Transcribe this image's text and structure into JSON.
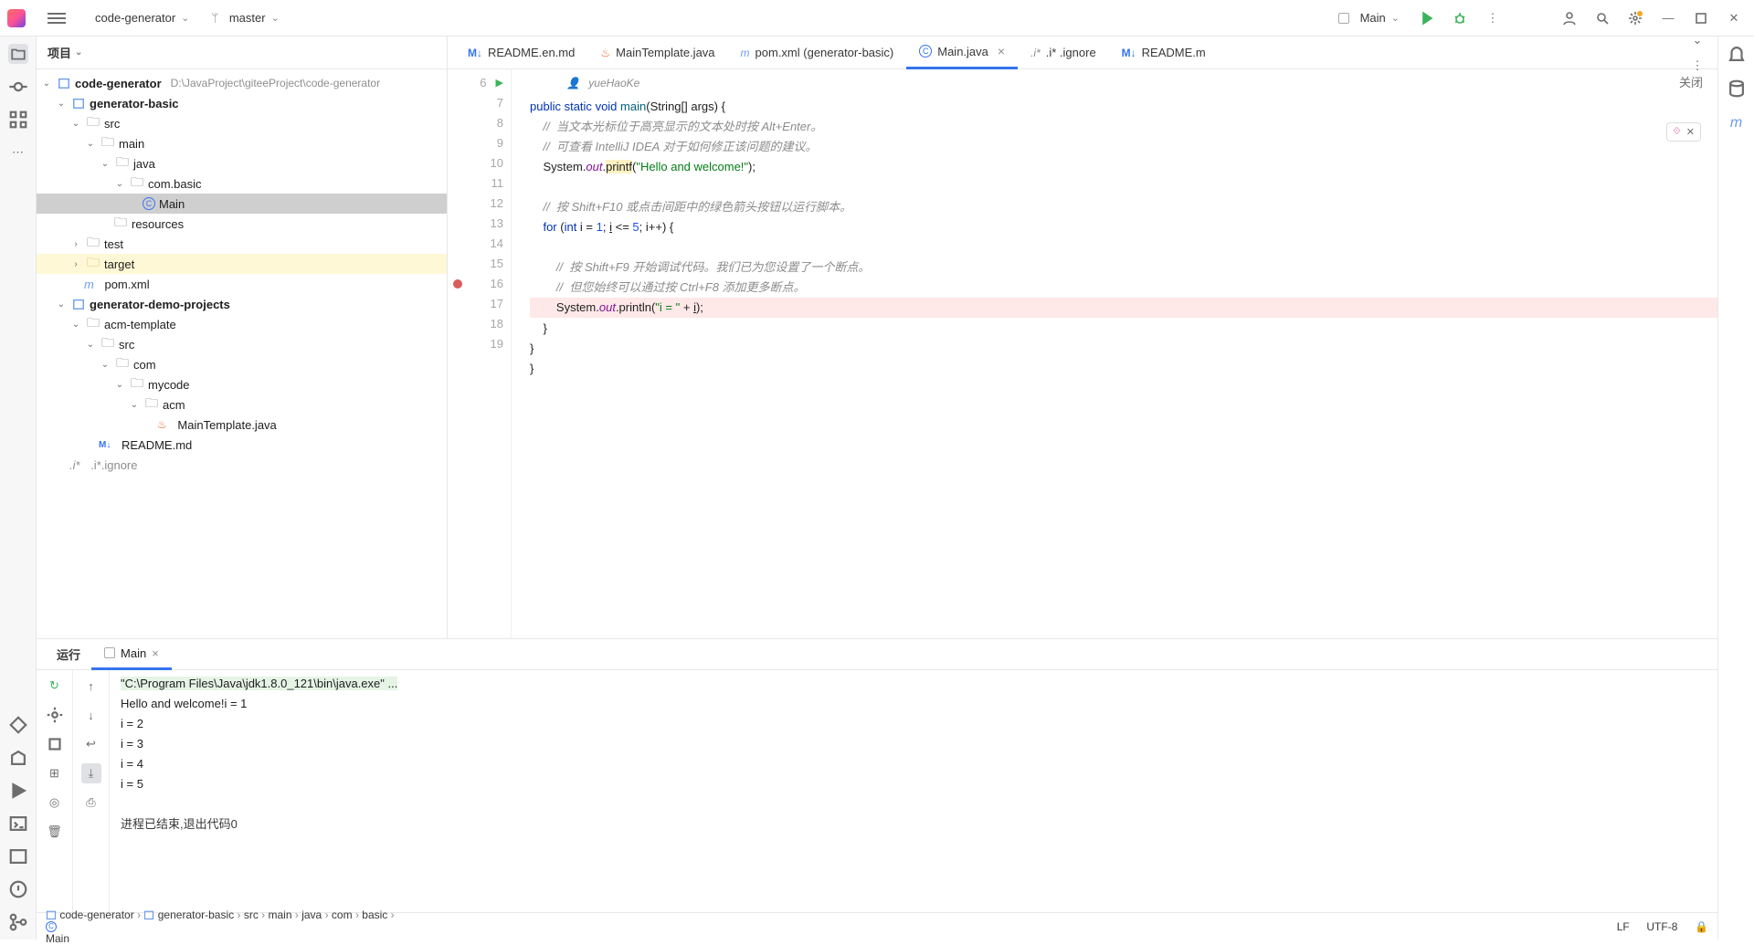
{
  "top": {
    "project": "code-generator",
    "branch": "master",
    "runConfig": "Main"
  },
  "panel": {
    "title": "项目"
  },
  "tree": {
    "root": "code-generator",
    "rootPath": "D:\\JavaProject\\giteeProject\\code-generator",
    "n1": "generator-basic",
    "n2": "src",
    "n3": "main",
    "n4": "java",
    "n5": "com.basic",
    "n6": "Main",
    "n7": "resources",
    "n8": "test",
    "n9": "target",
    "n10": "pom.xml",
    "n11": "generator-demo-projects",
    "n12": "acm-template",
    "n13": "src",
    "n14": "com",
    "n15": "mycode",
    "n16": "acm",
    "n17": "MainTemplate.java",
    "n18": "README.md",
    "n19": ".i*.ignore"
  },
  "tabs": [
    {
      "label": "README.en.md",
      "icon": "md"
    },
    {
      "label": "MainTemplate.java",
      "icon": "jv"
    },
    {
      "label": "pom.xml (generator-basic)",
      "icon": "mvn"
    },
    {
      "label": "Main.java",
      "icon": "cblue",
      "active": true,
      "close": true
    },
    {
      "label": ".i* .ignore",
      "icon": ""
    },
    {
      "label": "README.m",
      "icon": "md"
    }
  ],
  "editor": {
    "author": "yueHaoKe",
    "closeLabel": "关闭",
    "lines": [
      {
        "n": 6,
        "run": true,
        "html": "<span class='kw'>public</span> <span class='kw'>static</span> <span class='kw'>void</span> <span style='color:#00627a'>main</span>(String[] args) {"
      },
      {
        "n": 7,
        "html": "    <span class='cmt'>//  当文本光标位于高亮显示的文本处时按 Alt+Enter。</span>"
      },
      {
        "n": 8,
        "html": "    <span class='cmt'>//  可查看 IntelliJ IDEA 对于如何修正该问题的建议。</span>"
      },
      {
        "n": 9,
        "html": "    System.<span class='fld'>out</span>.<span class='hly'>printf</span>(<span class='str'>\"Hello and welcome!\"</span>);"
      },
      {
        "n": 10,
        "html": ""
      },
      {
        "n": 11,
        "html": "    <span class='cmt'>//  按 Shift+F10 或点击间距中的绿色箭头按钮以运行脚本。</span>"
      },
      {
        "n": 12,
        "html": "    <span class='kw'>for</span> (<span class='kw'>int</span> i = <span class='num'>1</span>; <u>i</u> &lt;= <span class='num'>5</span>; i++) {"
      },
      {
        "n": 13,
        "html": ""
      },
      {
        "n": 14,
        "html": "        <span class='cmt'>//  按 Shift+F9 开始调试代码。我们已为您设置了一个断点。</span>"
      },
      {
        "n": 15,
        "html": "        <span class='cmt'>//  但您始终可以通过按 Ctrl+F8 添加更多断点。</span>"
      },
      {
        "n": 16,
        "bp": true,
        "err": true,
        "html": "        System.<span class='fld'>out</span>.println(<span class='str'>\"i = \"</span> + <u>i</u>);"
      },
      {
        "n": 17,
        "html": "    }"
      },
      {
        "n": 18,
        "html": "}"
      },
      {
        "n": 19,
        "html": "}"
      }
    ]
  },
  "run": {
    "title": "运行",
    "tab": "Main",
    "cmd": "\"C:\\Program Files\\Java\\jdk1.8.0_121\\bin\\java.exe\" ...",
    "out": [
      "Hello and welcome!i = 1",
      "i = 2",
      "i = 3",
      "i = 4",
      "i = 5"
    ],
    "exit": "进程已结束,退出代码0"
  },
  "breadcrumb": [
    "code-generator",
    "generator-basic",
    "src",
    "main",
    "java",
    "com",
    "basic",
    "Main"
  ],
  "status": {
    "lf": "LF",
    "enc": "UTF-8"
  }
}
